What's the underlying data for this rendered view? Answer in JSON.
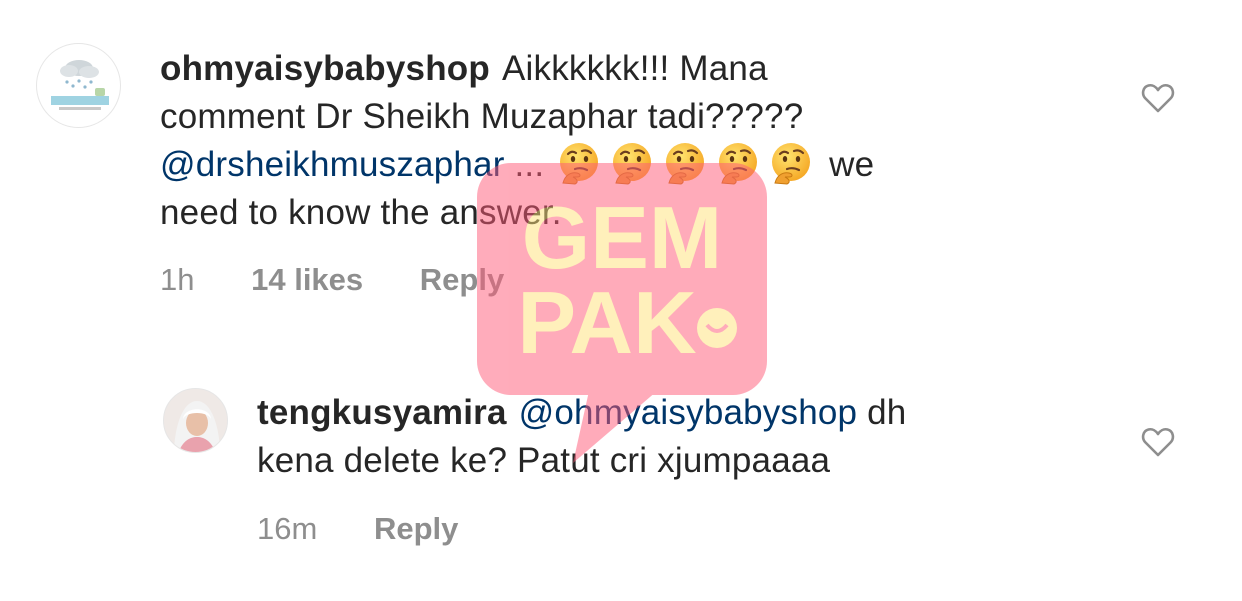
{
  "comments": [
    {
      "username": "ohmyaisybabyshop",
      "text_line1": "Aikkkkkk!!! Mana",
      "text_line2": "comment Dr Sheikh Muzaphar tadi?????",
      "mention": "@drsheikhmuszaphar",
      "text_after_mention": " ... ",
      "emoji": "thinking-face",
      "emoji_count": 5,
      "text_line3_tail": " we",
      "text_line4": "need to know the answer.",
      "time": "1h",
      "likes": "14 likes",
      "reply_label": "Reply"
    },
    {
      "username": "tengkusyamira",
      "mention": "@ohmyaisybabyshop",
      "text_after_mention": " dh",
      "text_line2": "kena delete ke? Patut cri xjumpaaaa",
      "time": "16m",
      "reply_label": "Reply"
    }
  ],
  "watermark": {
    "line1": "GEM",
    "line2": "PAK",
    "color": "#ff5a78"
  }
}
